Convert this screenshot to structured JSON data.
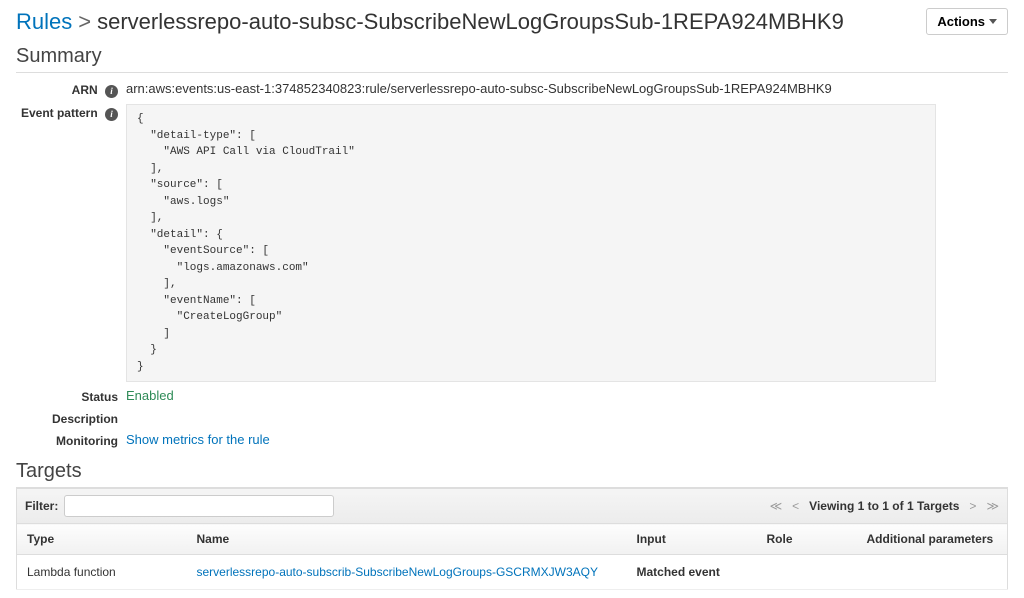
{
  "breadcrumb": {
    "root": "Rules",
    "separator": ">",
    "current": "serverlessrepo-auto-subsc-SubscribeNewLogGroupsSub-1REPA924MBHK9"
  },
  "actions": {
    "label": "Actions"
  },
  "summary": {
    "title": "Summary",
    "labels": {
      "arn": "ARN",
      "event_pattern": "Event pattern",
      "status": "Status",
      "description": "Description",
      "monitoring": "Monitoring"
    },
    "arn": "arn:aws:events:us-east-1:374852340823:rule/serverlessrepo-auto-subsc-SubscribeNewLogGroupsSub-1REPA924MBHK9",
    "event_pattern": "{\n  \"detail-type\": [\n    \"AWS API Call via CloudTrail\"\n  ],\n  \"source\": [\n    \"aws.logs\"\n  ],\n  \"detail\": {\n    \"eventSource\": [\n      \"logs.amazonaws.com\"\n    ],\n    \"eventName\": [\n      \"CreateLogGroup\"\n    ]\n  }\n}",
    "status": "Enabled",
    "description": "",
    "monitoring_link": "Show metrics for the rule"
  },
  "targets": {
    "title": "Targets",
    "filter_label": "Filter:",
    "filter_value": "",
    "pagination": {
      "text": "Viewing 1 to 1 of 1 Targets"
    },
    "columns": {
      "type": "Type",
      "name": "Name",
      "input": "Input",
      "role": "Role",
      "additional": "Additional parameters"
    },
    "rows": [
      {
        "type": "Lambda function",
        "name": "serverlessrepo-auto-subscrib-SubscribeNewLogGroups-GSCRMXJW3AQY",
        "input": "Matched event",
        "role": "",
        "additional": ""
      }
    ]
  }
}
